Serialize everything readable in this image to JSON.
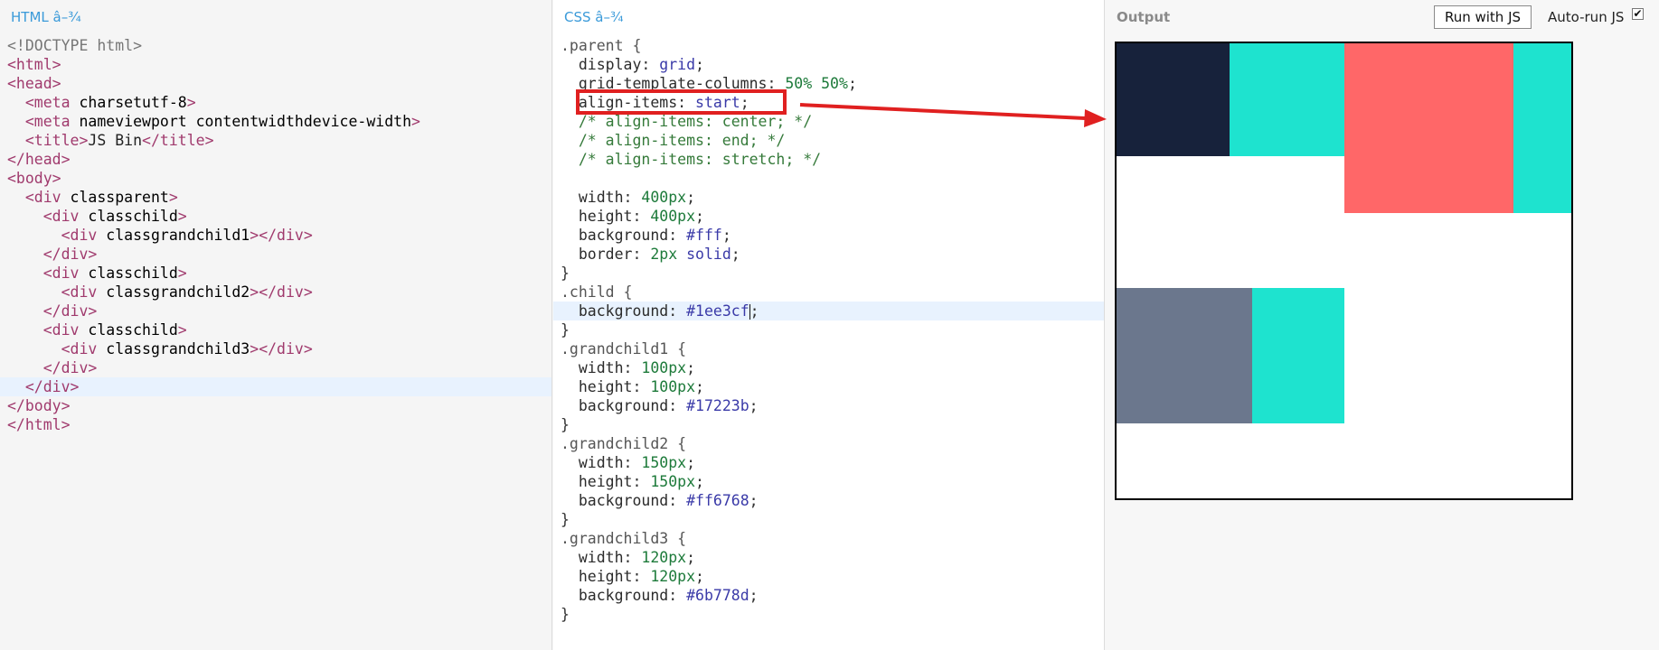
{
  "html_panel": {
    "title": "HTML â–¾",
    "lines": [
      "<!DOCTYPE html>",
      "<html>",
      "<head>",
      "  <meta charset=\"utf-8\">",
      "  <meta name=\"viewport\" content=\"width=device-width\">",
      "  <title>JS Bin</title>",
      "</head>",
      "<body>",
      "  <div class=\"parent\">",
      "    <div class=\"child\">",
      "      <div class=\"grandchild1\"></div>",
      "    </div>",
      "    <div class=\"child\">",
      "      <div class=\"grandchild2\"></div>",
      "    </div>",
      "    <div class=\"child\">",
      "      <div class=\"grandchild3\"></div>",
      "    </div>",
      "  </div>",
      "</body>",
      "</html>"
    ],
    "active_line": 18
  },
  "css_panel": {
    "title": "CSS â–¾",
    "lines": [
      ".parent {",
      "  display: grid;",
      "  grid-template-columns: 50% 50%;",
      "  align-items: start;",
      "  /* align-items: center; */",
      "  /* align-items: end; */",
      "  /* align-items: stretch; */",
      "",
      "  width: 400px;",
      "  height: 400px;",
      "  background: #fff;",
      "  border: 2px solid;",
      "}",
      ".child {",
      "  background: #1ee3cf;",
      "}",
      ".grandchild1 {",
      "  width: 100px;",
      "  height: 100px;",
      "  background: #17223b;",
      "}",
      ".grandchild2 {",
      "  width: 150px;",
      "  height: 150px;",
      "  background: #ff6768;",
      "}",
      ".grandchild3 {",
      "  width: 120px;",
      "  height: 120px;",
      "  background: #6b778d;",
      "}"
    ],
    "active_line": 14
  },
  "output_panel": {
    "title": "Output",
    "run_button_label": "Run with JS",
    "autorun_label": "Auto-run JS",
    "autorun_checked": true,
    "checkbox_glyph": "✔"
  },
  "annotation": {
    "highlight_color": "#e02020"
  },
  "colors": {
    "child": "#1ee3cf",
    "grandchild1": "#17223b",
    "grandchild2": "#ff6768",
    "grandchild3": "#6b778d"
  }
}
